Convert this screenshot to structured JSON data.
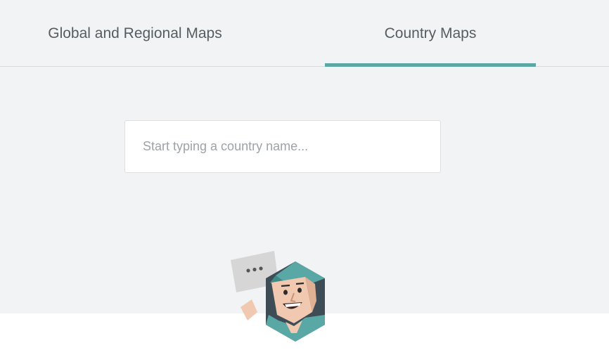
{
  "tabs": [
    {
      "label": "Global and Regional Maps",
      "active": false
    },
    {
      "label": "Country Maps",
      "active": true
    }
  ],
  "search": {
    "placeholder": "Start typing a country name...",
    "value": ""
  },
  "colors": {
    "accent": "#5aa8a5",
    "background": "#f2f3f5"
  },
  "mascot": {
    "icon": "mascot-illustration",
    "bubble_icon": "speech-bubble-icon"
  }
}
